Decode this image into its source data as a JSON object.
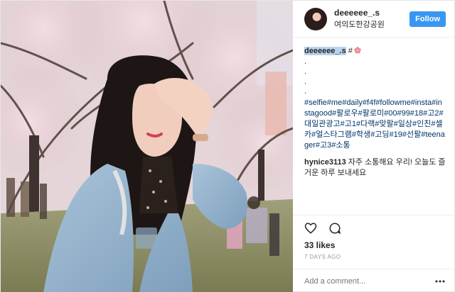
{
  "post": {
    "username": "deeeeee_.s",
    "location": "여의도한강공원",
    "follow_label": "Follow",
    "caption_user": "deeeeee_.s",
    "caption_text": " #",
    "caption_icon": "cherry-blossom-icon",
    "caption_dots": [
      ".",
      ".",
      ".",
      "."
    ],
    "hashtags": "#selfie#me#daily#f4f#followme#insta#instagood#팔로우#팔로미#00#99#18#고2#대일관광고#고1#다랙#맞팔#일상#인친#셀카#얼스타그램#학생#고딩#19#선팔#teenager#고3#소통",
    "comment_user": "hynice3113",
    "comment_text": " 자주 소통해요 우리! 오늘도 즐거운 하루 보내세요",
    "likes": "33 likes",
    "time": "7 DAYS AGO",
    "add_comment_placeholder": "Add a comment..."
  },
  "icons": {
    "like": "heart-icon",
    "comment": "speech-bubble-icon",
    "more": "more-options-icon"
  },
  "colors": {
    "follow_button": "#3897f0",
    "hashtag": "#003569",
    "muted": "#999999"
  }
}
